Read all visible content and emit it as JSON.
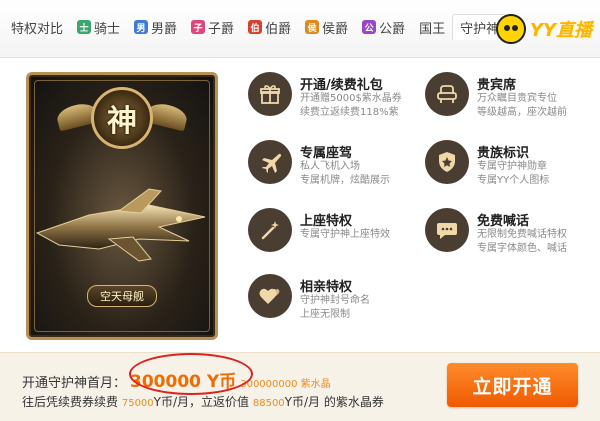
{
  "tabs": [
    {
      "label": "特权对比",
      "badge": "",
      "badge_color": ""
    },
    {
      "label": "骑士",
      "badge": "士",
      "badge_color": "#3aa66a"
    },
    {
      "label": "男爵",
      "badge": "男",
      "badge_color": "#3f7bd6"
    },
    {
      "label": "子爵",
      "badge": "子",
      "badge_color": "#e0467a"
    },
    {
      "label": "伯爵",
      "badge": "伯",
      "badge_color": "#d9412f"
    },
    {
      "label": "侯爵",
      "badge": "侯",
      "badge_color": "#e08a1a"
    },
    {
      "label": "公爵",
      "badge": "公",
      "badge_color": "#9a46c8"
    },
    {
      "label": "国王",
      "badge": "",
      "badge_color": ""
    },
    {
      "label": "守护神",
      "badge": "",
      "badge_color": ""
    }
  ],
  "logo": {
    "text": "YY直播"
  },
  "card": {
    "emblem_char": "神",
    "ship_label": "空天母舰"
  },
  "features": [
    {
      "title": "开通/续费礼包",
      "desc1": "开通赠5000$紫水晶券",
      "desc2": "续费立返续费118%紫",
      "icon": "gift-icon"
    },
    {
      "title": "贵宾席",
      "desc1": "万众瞩目贵宾专位",
      "desc2": "等级越高，座次越前",
      "icon": "armchair-icon"
    },
    {
      "title": "专属座驾",
      "desc1": "私人飞机入场",
      "desc2": "专属机牌，炫酷展示",
      "icon": "airplane-icon"
    },
    {
      "title": "贵族标识",
      "desc1": "专属守护神勋章",
      "desc2": "专属YY个人图标",
      "icon": "shield-icon"
    },
    {
      "title": "上座特权",
      "desc1": "专属守护神上座特效",
      "desc2": "",
      "icon": "magic-wand-icon"
    },
    {
      "title": "免费喊话",
      "desc1": "无限制免费喊话特权",
      "desc2": "专属字体颜色、喊话",
      "icon": "chat-bubble-icon"
    },
    {
      "title": "相亲特权",
      "desc1": "守护神封号命名",
      "desc2": "上座无限制",
      "icon": "hearts-icon"
    }
  ],
  "bottom": {
    "first_month_label": "开通守护神首月：",
    "price": "300000 Y币",
    "crystal": "300000000 紫水晶",
    "renew_prefix": "往后凭续费券续费",
    "renew_price": "75000",
    "renew_mid": "Y币/月，立返价值",
    "renew_value": "88500",
    "renew_suffix": "Y币/月 的紫水晶券",
    "open_button": "立即开通"
  },
  "colors": {
    "accent": "#f26b00",
    "icon_bg": "#4a3e33",
    "circle_mark": "#e02020"
  }
}
